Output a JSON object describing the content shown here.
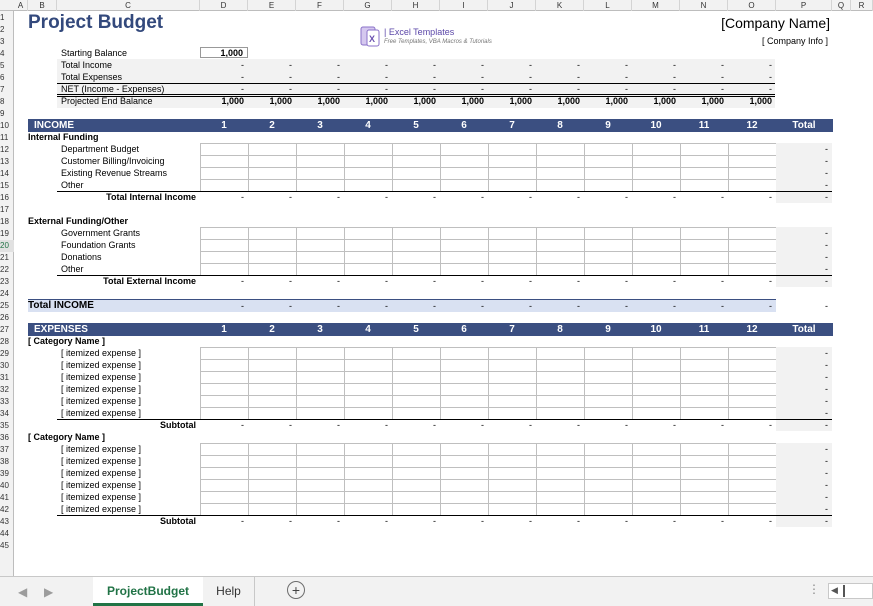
{
  "columns": [
    "A",
    "B",
    "C",
    "D",
    "E",
    "F",
    "G",
    "H",
    "I",
    "J",
    "K",
    "L",
    "M",
    "N",
    "O",
    "P",
    "Q",
    "R"
  ],
  "rows": [
    "1",
    "2",
    "3",
    "4",
    "5",
    "6",
    "7",
    "8",
    "9",
    "10",
    "11",
    "12",
    "13",
    "14",
    "15",
    "16",
    "17",
    "18",
    "19",
    "20",
    "21",
    "22",
    "23",
    "24",
    "25",
    "26",
    "27",
    "28",
    "29",
    "30",
    "31",
    "32",
    "33",
    "34",
    "35",
    "36",
    "37",
    "38",
    "39",
    "40",
    "41",
    "42",
    "43",
    "44",
    "45"
  ],
  "selected_row": "20",
  "title": "Project Budget",
  "company_name": "[Company Name]",
  "company_info": "[ Company Info ]",
  "logo": {
    "brand": "| Excel Templates",
    "tagline": "Free Templates, VBA Macros & Tutorials",
    "icon": "excel-logo-icon"
  },
  "summary": {
    "starting_balance_label": "Starting Balance",
    "starting_balance_value": "1,000",
    "rows": [
      {
        "label": "Total Income",
        "values": [
          "-",
          "-",
          "-",
          "-",
          "-",
          "-",
          "-",
          "-",
          "-",
          "-",
          "-",
          "-"
        ]
      },
      {
        "label": "Total Expenses",
        "values": [
          "-",
          "-",
          "-",
          "-",
          "-",
          "-",
          "-",
          "-",
          "-",
          "-",
          "-",
          "-"
        ]
      },
      {
        "label": "NET (Income - Expenses)",
        "values": [
          "-",
          "-",
          "-",
          "-",
          "-",
          "-",
          "-",
          "-",
          "-",
          "-",
          "-",
          "-"
        ]
      },
      {
        "label": "Projected End Balance",
        "values": [
          "1,000",
          "1,000",
          "1,000",
          "1,000",
          "1,000",
          "1,000",
          "1,000",
          "1,000",
          "1,000",
          "1,000",
          "1,000",
          "1,000"
        ]
      }
    ]
  },
  "months": [
    "1",
    "2",
    "3",
    "4",
    "5",
    "6",
    "7",
    "8",
    "9",
    "10",
    "11",
    "12"
  ],
  "total_label": "Total",
  "dash": "-",
  "income": {
    "header": "INCOME",
    "groups": [
      {
        "title": "Internal Funding",
        "items": [
          "Department Budget",
          "Customer Billing/Invoicing",
          "Existing Revenue Streams",
          "Other"
        ],
        "total_label": "Total Internal Income"
      },
      {
        "title": "External Funding/Other",
        "items": [
          "Government Grants",
          "Foundation Grants",
          "Donations",
          "Other"
        ],
        "total_label": "Total External Income"
      }
    ],
    "total_label": "Total INCOME"
  },
  "expenses": {
    "header": "EXPENSES",
    "groups": [
      {
        "title": "[ Category Name ]",
        "items": [
          "[ itemized expense ]",
          "[ itemized expense ]",
          "[ itemized expense ]",
          "[ itemized expense ]",
          "[ itemized expense ]",
          "[ itemized expense ]"
        ],
        "total_label": "Subtotal"
      },
      {
        "title": "[ Category Name ]",
        "items": [
          "[ itemized expense ]",
          "[ itemized expense ]",
          "[ itemized expense ]",
          "[ itemized expense ]",
          "[ itemized expense ]",
          "[ itemized expense ]"
        ],
        "total_label": "Subtotal"
      }
    ]
  },
  "tabs": [
    {
      "label": "ProjectBudget",
      "active": true
    },
    {
      "label": "Help",
      "active": false
    }
  ],
  "colors": {
    "header_band": "#3b4f81",
    "title": "#33497c",
    "total_income_band": "#d9e1f2",
    "accent": "#217346"
  }
}
